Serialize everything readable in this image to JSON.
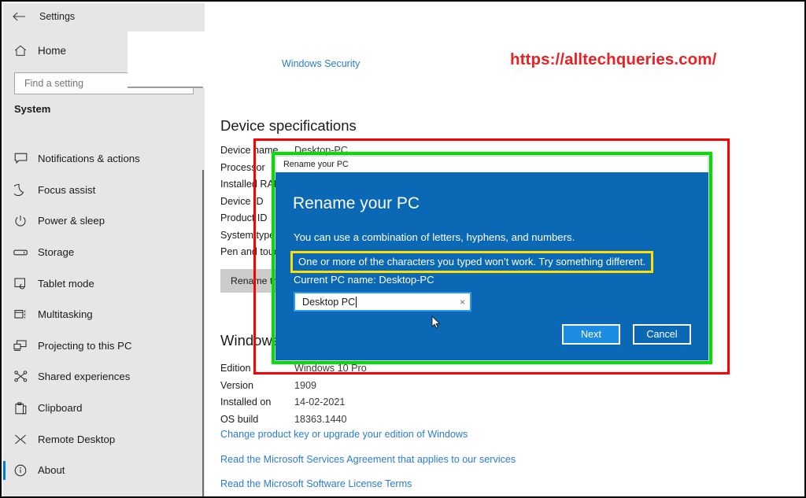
{
  "window": {
    "titlebar_text": "Settings",
    "back_icon": "back-arrow-icon"
  },
  "sidebar": {
    "home_label": "Home",
    "home_icon": "home-icon",
    "search_placeholder": "Find a setting",
    "section_title": "System",
    "items": [
      {
        "label": "Notifications & actions",
        "icon": "notification-icon",
        "selected": false
      },
      {
        "label": "Focus assist",
        "icon": "moon-icon",
        "selected": false
      },
      {
        "label": "Power & sleep",
        "icon": "power-icon",
        "selected": false
      },
      {
        "label": "Storage",
        "icon": "storage-icon",
        "selected": false
      },
      {
        "label": "Tablet mode",
        "icon": "tablet-icon",
        "selected": false
      },
      {
        "label": "Multitasking",
        "icon": "multitasking-icon",
        "selected": false
      },
      {
        "label": "Projecting to this PC",
        "icon": "projecting-icon",
        "selected": false
      },
      {
        "label": "Shared experiences",
        "icon": "shared-icon",
        "selected": false
      },
      {
        "label": "Clipboard",
        "icon": "clipboard-icon",
        "selected": false
      },
      {
        "label": "Remote Desktop",
        "icon": "remote-desktop-icon",
        "selected": false
      },
      {
        "label": "About",
        "icon": "info-icon",
        "selected": true
      }
    ]
  },
  "content": {
    "windows_security_link": "Windows Security",
    "watermark": "https://alltechqueries.com/",
    "device_specs_heading": "Device specifications",
    "device_specs": [
      {
        "label": "Device name",
        "value": "Desktop-PC"
      },
      {
        "label": "Processor",
        "value": ""
      },
      {
        "label": "Installed RAM",
        "value": ""
      },
      {
        "label": "Device ID",
        "value": ""
      },
      {
        "label": "Product ID",
        "value": ""
      },
      {
        "label": "System type",
        "value": ""
      },
      {
        "label": "Pen and touch",
        "value": ""
      }
    ],
    "rename_button_label": "Rename this PC",
    "windows_specs_heading": "Windows specifications",
    "windows_specs": [
      {
        "label": "Edition",
        "value": "Windows 10 Pro"
      },
      {
        "label": "Version",
        "value": "1909"
      },
      {
        "label": "Installed on",
        "value": "14-02-2021"
      },
      {
        "label": "OS build",
        "value": "18363.1440"
      }
    ],
    "links": [
      "Change product key or upgrade your edition of Windows",
      "Read the Microsoft Services Agreement that applies to our services",
      "Read the Microsoft Software License Terms"
    ]
  },
  "dialog": {
    "titlebar_text": "Rename your PC",
    "heading": "Rename your PC",
    "subtitle": "You can use a combination of letters, hyphens, and numbers.",
    "error_message": "One or more of the characters you typed won’t work. Try something different.",
    "current_pc_name": "Current PC name: Desktop-PC",
    "input_value": "Desktop PC",
    "clear_icon": "×",
    "next_label": "Next",
    "cancel_label": "Cancel"
  },
  "annotations": {
    "red_box_color": "#ff0000",
    "green_box_color": "#00e400",
    "yellow_box_color": "#ffde00"
  }
}
